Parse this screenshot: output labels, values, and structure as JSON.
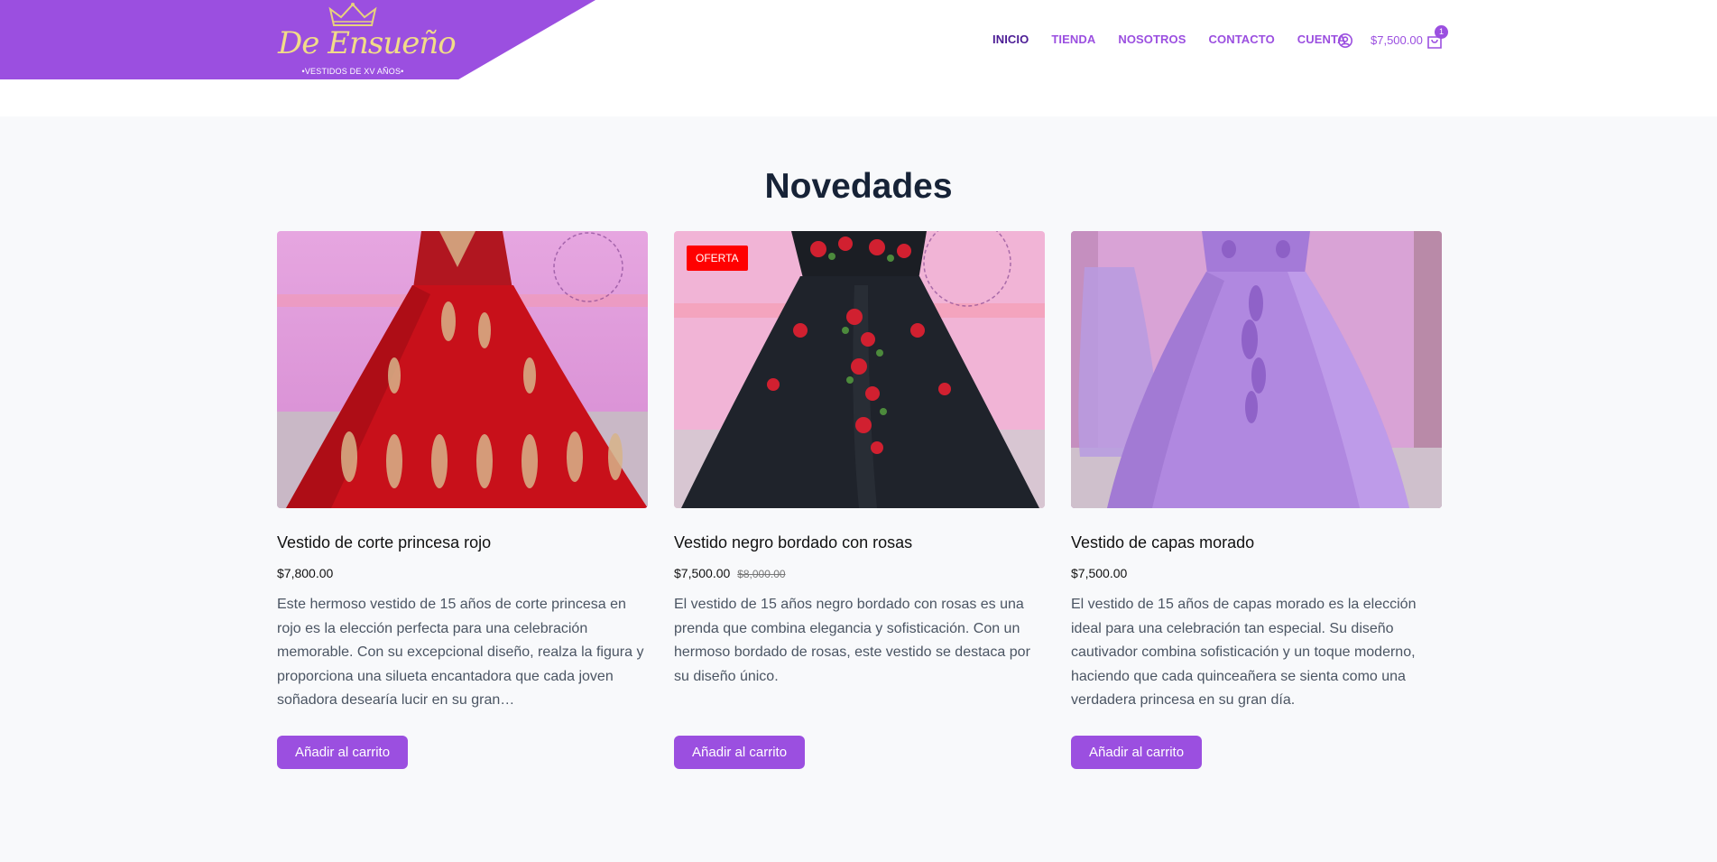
{
  "brand": {
    "name": "De Ensueño",
    "tagline": "•VESTIDOS DE XV AÑOS•",
    "color": "#9b4fe0"
  },
  "nav": {
    "items": [
      "INICIO",
      "TIENDA",
      "NOSOTROS",
      "CONTACTO",
      "CUENTA"
    ],
    "active": "INICIO"
  },
  "header_icons": {
    "account_icon": "user-circle-icon",
    "cart_icon": "shopping-bag-icon"
  },
  "cart": {
    "total": "$7,500.00",
    "count": "1"
  },
  "section": {
    "title": "Novedades"
  },
  "products": [
    {
      "title": "Vestido de corte princesa rojo",
      "price": "$7,800.00",
      "old_price": "",
      "badge": "",
      "description": "Este hermoso vestido de 15 años de corte princesa en rojo es la elección perfecta para una celebración memorable. Con su excepcional diseño, realza la figura y proporciona una silueta encantadora que cada joven soñadora desearía lucir en su gran…",
      "button": "Añadir al carrito",
      "dress_color": "#c8101a"
    },
    {
      "title": "Vestido negro bordado con rosas",
      "price": "$7,500.00",
      "old_price": "$8,000.00",
      "badge": "OFERTA",
      "description": "El vestido de 15 años negro bordado con rosas es una prenda que combina elegancia y sofisticación. Con un hermoso bordado de rosas, este vestido se destaca por su diseño único.",
      "button": "Añadir al carrito",
      "dress_color": "#1b1e24"
    },
    {
      "title": "Vestido de capas morado",
      "price": "$7,500.00",
      "old_price": "",
      "badge": "",
      "description": "El vestido de 15 años de capas morado es la elección ideal para una celebración tan especial. Su diseño cautivador combina sofisticación y un toque moderno, haciendo que cada quinceañera se sienta como una verdadera princesa en su gran día.",
      "button": "Añadir al carrito",
      "dress_color": "#b088e0"
    }
  ]
}
